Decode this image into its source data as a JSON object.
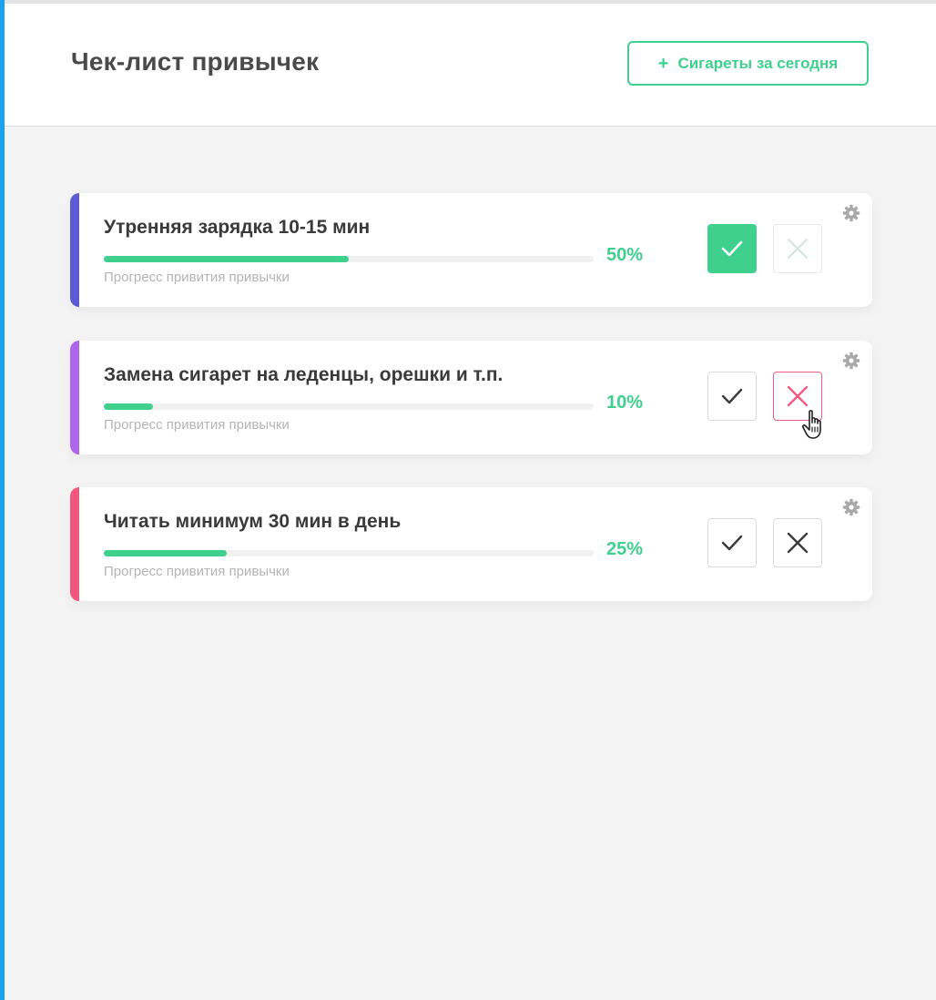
{
  "header": {
    "title": "Чек-лист привычек",
    "add_button": {
      "icon": "+",
      "label": "Сигареты за сегодня"
    }
  },
  "habits": [
    {
      "title": "Утренняя зарядка 10-15 мин",
      "progress": 0.5,
      "progress_text": "50%",
      "progress_caption": "Прогресс привития привычки",
      "accent_color": "#5b5bd6",
      "check_state": "checked",
      "cross_state": "faded"
    },
    {
      "title": "Замена сигарет на леденцы, орешки и т.п.",
      "progress": 0.1,
      "progress_text": "10%",
      "progress_caption": "Прогресс привития привычки",
      "accent_color": "#b066ea",
      "check_state": "default",
      "cross_state": "hover"
    },
    {
      "title": "Читать минимум 30 мин в день",
      "progress": 0.25,
      "progress_text": "25%",
      "progress_caption": "Прогресс привития привычки",
      "accent_color": "#f2557d",
      "check_state": "default",
      "cross_state": "default"
    }
  ],
  "colors": {
    "primary_green": "#3fd08e",
    "danger_pink": "#f25c82",
    "frame_blue": "#1aa3f0"
  },
  "icons": [
    "plus-icon",
    "check-icon",
    "close-icon",
    "gear-icon",
    "hand-pointer-icon"
  ]
}
